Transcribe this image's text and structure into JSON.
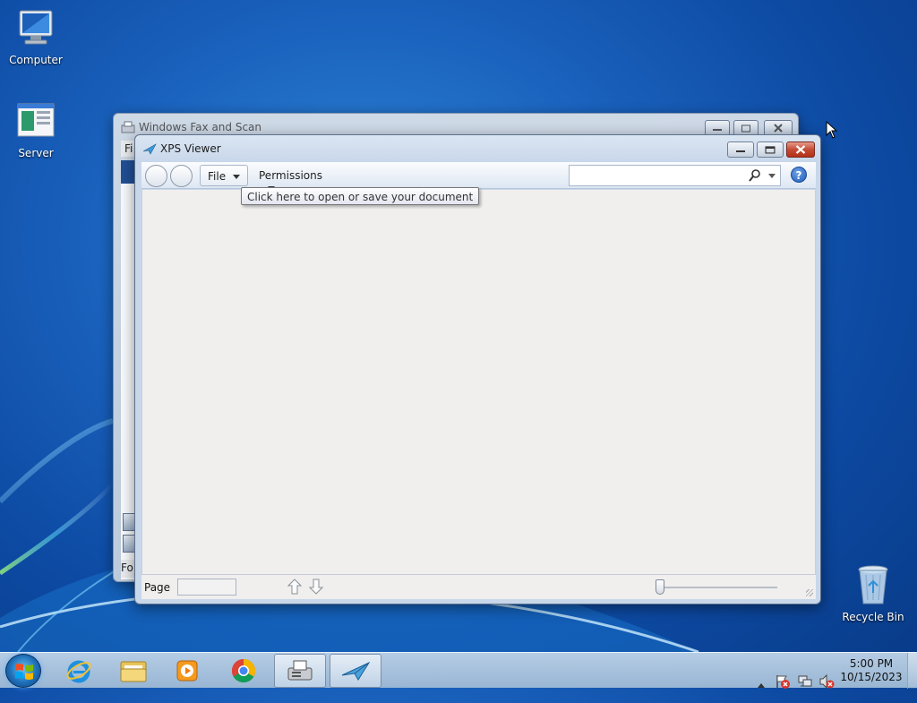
{
  "desktop": {
    "icons": [
      {
        "label": "Computer"
      },
      {
        "label": "Server"
      },
      {
        "label": "Recycle Bin"
      }
    ]
  },
  "fax_window": {
    "title": "Windows Fax and Scan",
    "menu_first_text": "Fi",
    "status_text": "Fo"
  },
  "xps_window": {
    "title": "XPS Viewer",
    "toolbar": {
      "file_label": "File",
      "permissions_label": "Permissions",
      "search_value": ""
    },
    "tooltip": "Click here to open or save your document",
    "statusbar": {
      "page_label": "Page",
      "page_value": ""
    }
  },
  "taskbar": {
    "clock_time": "5:00 PM",
    "clock_date": "10/15/2023",
    "pinned": [
      {
        "name": "internet-explorer"
      },
      {
        "name": "windows-explorer"
      },
      {
        "name": "media-player"
      },
      {
        "name": "chrome"
      },
      {
        "name": "fax-and-scan",
        "active": true
      },
      {
        "name": "xps-viewer",
        "active": true
      }
    ]
  },
  "colors": {
    "desktop_blue": "#1a62bd",
    "close_red": "#c44b34",
    "window_frame": "#c8d7ea"
  }
}
